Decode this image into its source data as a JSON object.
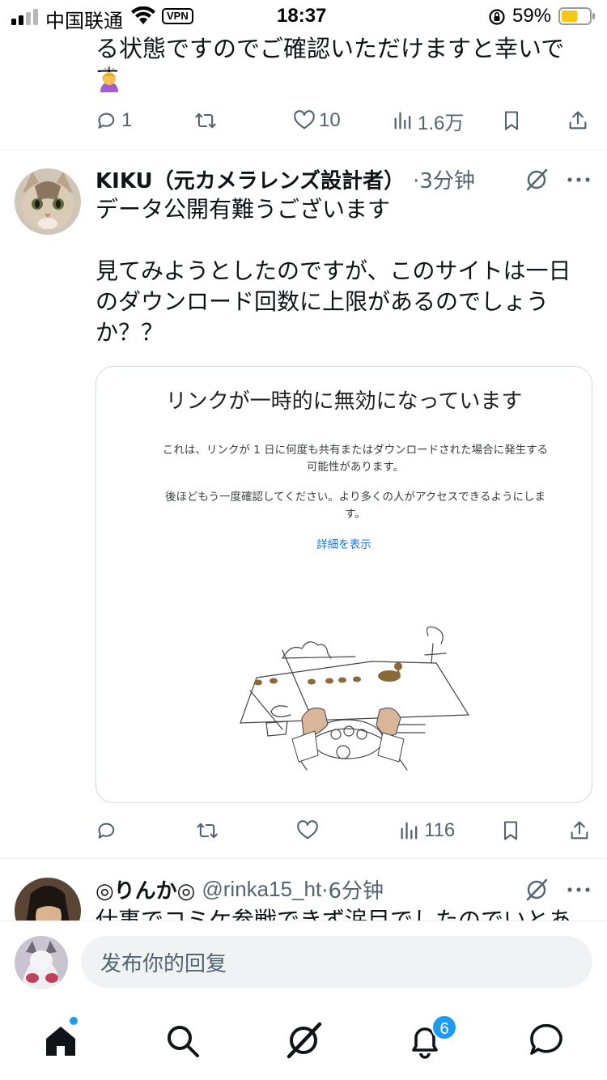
{
  "status_bar": {
    "carrier": "中国联通",
    "vpn": "VPN",
    "time": "18:37",
    "battery_percent": "59%",
    "battery_level": 0.59
  },
  "prev_tweet": {
    "text": "る状態ですのでご確認いただけますと幸いです",
    "emoji": "person-bowing-emoji",
    "replies": "1",
    "retweets": "",
    "likes": "10",
    "views": "1.6万"
  },
  "tweet": {
    "author_name": "KIKU（元カメラレンズ設計者）",
    "time": "·3分钟",
    "text": "データ公開有難うございます\n\n見てみようとしたのですが、このサイトは一日のダウンロード回数に上限があるのでしょうか？？",
    "card": {
      "title": "リンクが一時的に無効になっています",
      "p1": "これは、リンクが 1 日に何度も共有またはダウンロードされた場合に発生する可能性があります。",
      "p2": "後ほどもう一度確認してください。より多くの人がアクセスできるようにします。",
      "link": "詳細を表示",
      "illustration": "ducks-crossing-road-illustration"
    },
    "replies": "",
    "retweets": "",
    "likes": "",
    "views": "116"
  },
  "tweet3": {
    "author_name": "◎りんか◎",
    "handle": "@rinka15_ht",
    "time": "·6分钟",
    "text": "仕事でコミケ参戦できず涙目でしたのでいとあ"
  },
  "reply_bar": {
    "placeholder": "发布你的回复"
  },
  "tab_bar": {
    "items": [
      "home-icon",
      "search-icon",
      "grok-icon",
      "notifications-icon",
      "messages-icon"
    ],
    "notifications_count": "6"
  },
  "colors": {
    "accent": "#1d9bf0",
    "secondary_text": "#536471",
    "battery": "#f5c518"
  }
}
